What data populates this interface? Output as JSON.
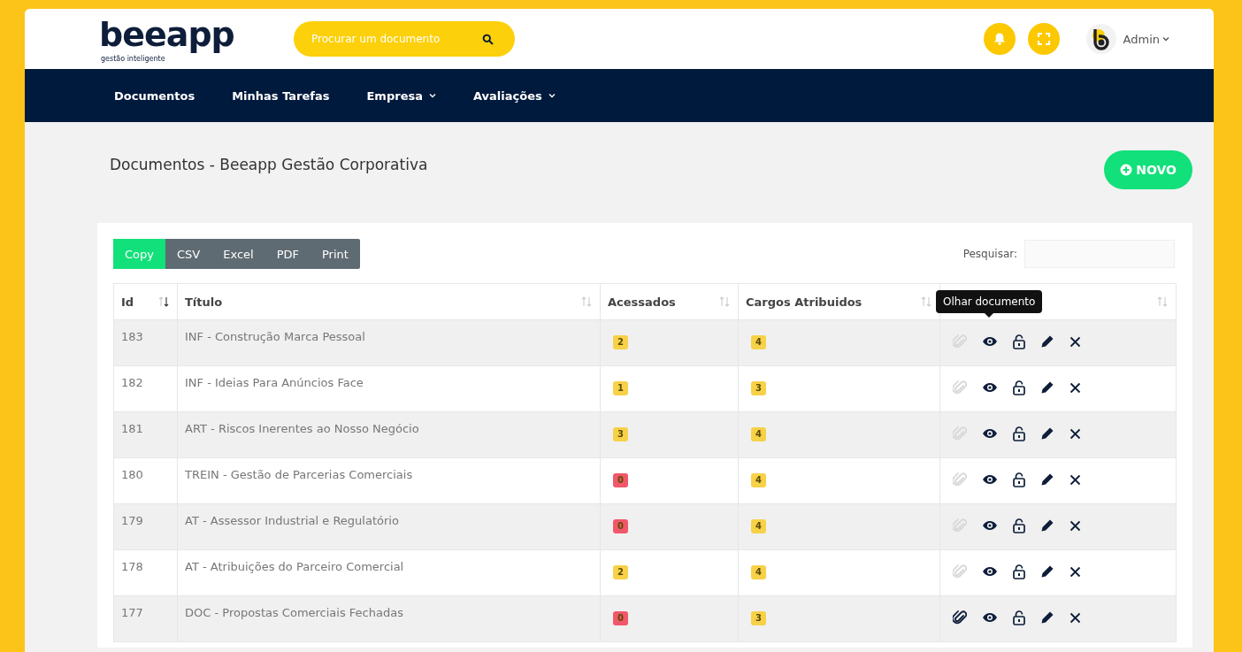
{
  "header": {
    "logo": "beeapp",
    "logo_tagline": "gestão inteligente",
    "search": {
      "placeholder": "Procurar um documento"
    },
    "user": "Admin"
  },
  "nav": [
    {
      "label": "Documentos",
      "dropdown": false
    },
    {
      "label": "Minhas Tarefas",
      "dropdown": false
    },
    {
      "label": "Empresa",
      "dropdown": true
    },
    {
      "label": "Avaliações",
      "dropdown": true
    }
  ],
  "page": {
    "title": "Documentos - Beeapp Gestão Corporativa",
    "new_button": "NOVO"
  },
  "toolbar": [
    {
      "label": "Copy",
      "selected": true
    },
    {
      "label": "CSV",
      "selected": false
    },
    {
      "label": "Excel",
      "selected": false
    },
    {
      "label": "PDF",
      "selected": false
    },
    {
      "label": "Print",
      "selected": false
    }
  ],
  "filter": {
    "label": "Pesquisar:"
  },
  "table": {
    "columns": [
      {
        "label": "Id",
        "sorted": true
      },
      {
        "label": "Título",
        "sorted": false
      },
      {
        "label": "Acessados",
        "sorted": false
      },
      {
        "label": "Cargos Atribuidos",
        "sorted": false
      },
      {
        "sorted": false
      }
    ],
    "tooltip": "Olhar documento",
    "rows": [
      {
        "id": "183",
        "title": "INF - Construção Marca Pessoal",
        "accessed": {
          "text": "2",
          "color": "#f7d148"
        },
        "roles": "4",
        "has_attachment": false
      },
      {
        "id": "182",
        "title": "INF - Ideias Para Anúncios Face",
        "accessed": {
          "text": "1",
          "color": "#f7d148"
        },
        "roles": "3",
        "has_attachment": false
      },
      {
        "id": "181",
        "title": "ART - Riscos Inerentes ao Nosso Negócio",
        "accessed": {
          "text": "3",
          "color": "#f7d148"
        },
        "roles": "4",
        "has_attachment": false
      },
      {
        "id": "180",
        "title": "TREIN - Gestão de Parcerias Comerciais",
        "accessed": {
          "text": "0",
          "color": "#f1576b"
        },
        "roles": "4",
        "has_attachment": false
      },
      {
        "id": "179",
        "title": "AT - Assessor Industrial e Regulatório",
        "accessed": {
          "text": "0",
          "color": "#f1576b"
        },
        "roles": "4",
        "has_attachment": false
      },
      {
        "id": "178",
        "title": "AT - Atribuições do Parceiro Comercial",
        "accessed": {
          "text": "2",
          "color": "#f7d148"
        },
        "roles": "4",
        "has_attachment": false
      },
      {
        "id": "177",
        "title": "DOC - Propostas Comerciais Fechadas",
        "accessed": {
          "text": "0",
          "color": "#f1576b"
        },
        "roles": "3",
        "has_attachment": true
      }
    ]
  }
}
